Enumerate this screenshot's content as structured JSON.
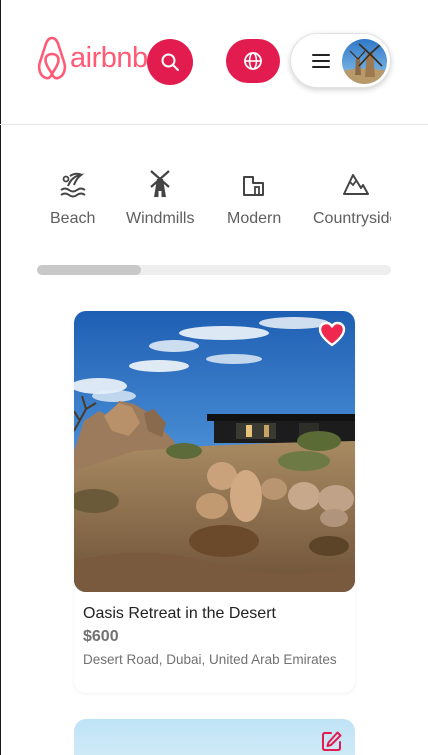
{
  "brand": {
    "name": "airbnb",
    "color": "#ff5a76",
    "accent": "#e31c4f"
  },
  "header": {
    "search_icon": "search-icon",
    "globe_icon": "globe-icon",
    "menu_icon": "hamburger-icon"
  },
  "categories": {
    "items": [
      {
        "label": "Beach",
        "icon": "beach-icon"
      },
      {
        "label": "Windmills",
        "icon": "windmill-icon"
      },
      {
        "label": "Modern",
        "icon": "modern-house-icon"
      },
      {
        "label": "Countryside",
        "icon": "mountain-icon"
      }
    ],
    "scroll_position": 0.29
  },
  "listings": [
    {
      "title": "Oasis Retreat in the Desert",
      "price": "$600",
      "location": "Desert Road, Dubai, United Arab Emirates",
      "favorited": true,
      "heart_color": "#f0284f"
    },
    {
      "action_icon": "edit-icon"
    }
  ]
}
